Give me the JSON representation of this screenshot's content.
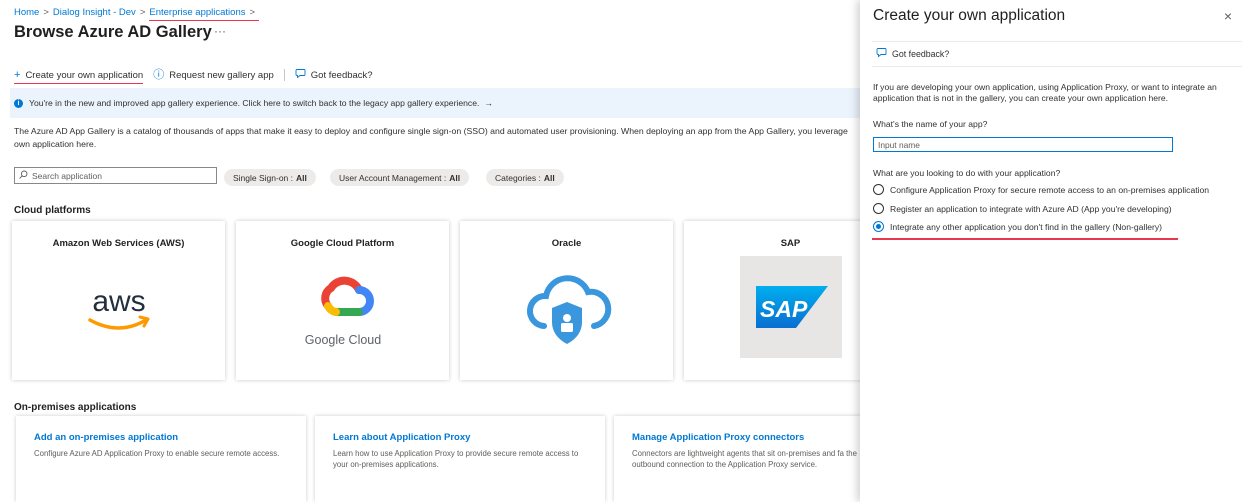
{
  "breadcrumb": {
    "items": [
      "Home",
      "Dialog Insight - Dev",
      "Enterprise applications"
    ],
    "separator": ">"
  },
  "page": {
    "title": "Browse Azure AD Gallery",
    "more_label": "···"
  },
  "toolbar": {
    "create_label": "Create your own application",
    "request_label": "Request new gallery app",
    "feedback_label": "Got feedback?"
  },
  "banner": {
    "text": "You're in the new and improved app gallery experience. Click here to switch back to the legacy app gallery experience.",
    "arrow": "→"
  },
  "description": "The Azure AD App Gallery is a catalog of thousands of apps that make it easy to deploy and configure single sign-on (SSO) and automated user provisioning. When deploying an app from the App Gallery, you leverage own application here.",
  "search": {
    "placeholder": "Search application"
  },
  "filters": [
    {
      "label": "Single Sign-on :",
      "value": "All"
    },
    {
      "label": "User Account Management :",
      "value": "All"
    },
    {
      "label": "Categories :",
      "value": "All"
    }
  ],
  "cloud": {
    "section_title": "Cloud platforms",
    "cards": [
      {
        "name": "Amazon Web Services (AWS)",
        "logo_text": "aws"
      },
      {
        "name": "Google Cloud Platform",
        "logo_text": "Google Cloud"
      },
      {
        "name": "Oracle"
      },
      {
        "name": "SAP",
        "logo_text": "SAP"
      }
    ]
  },
  "onprem": {
    "section_title": "On-premises applications",
    "cards": [
      {
        "title": "Add an on-premises application",
        "desc": "Configure Azure AD Application Proxy to enable secure remote access."
      },
      {
        "title": "Learn about Application Proxy",
        "desc": "Learn how to use Application Proxy to provide secure remote access to your on-premises applications."
      },
      {
        "title": "Manage Application Proxy connectors",
        "desc": "Connectors are lightweight agents that sit on-premises and fa the outbound connection to the Application Proxy service."
      }
    ]
  },
  "panel": {
    "title": "Create your own application",
    "close_label": "×",
    "feedback_label": "Got feedback?",
    "description": "If you are developing your own application, using Application Proxy, or want to integrate an application that is not in the gallery, you can create your own application here.",
    "name_label": "What's the name of your app?",
    "name_placeholder": "Input name",
    "purpose_label": "What are you looking to do with your application?",
    "options": [
      {
        "label": "Configure Application Proxy for secure remote access to an on-premises application",
        "selected": false
      },
      {
        "label": "Register an application to integrate with Azure AD (App you're developing)",
        "selected": false
      },
      {
        "label": "Integrate any other application you don't find in the gallery (Non-gallery)",
        "selected": true
      }
    ]
  },
  "colors": {
    "accent": "#0078d4",
    "highlight_underline": "#e8384f",
    "banner_bg": "#ebf3fc",
    "aws_orange": "#ff9900",
    "sap_blue": "#0a6ed1"
  }
}
